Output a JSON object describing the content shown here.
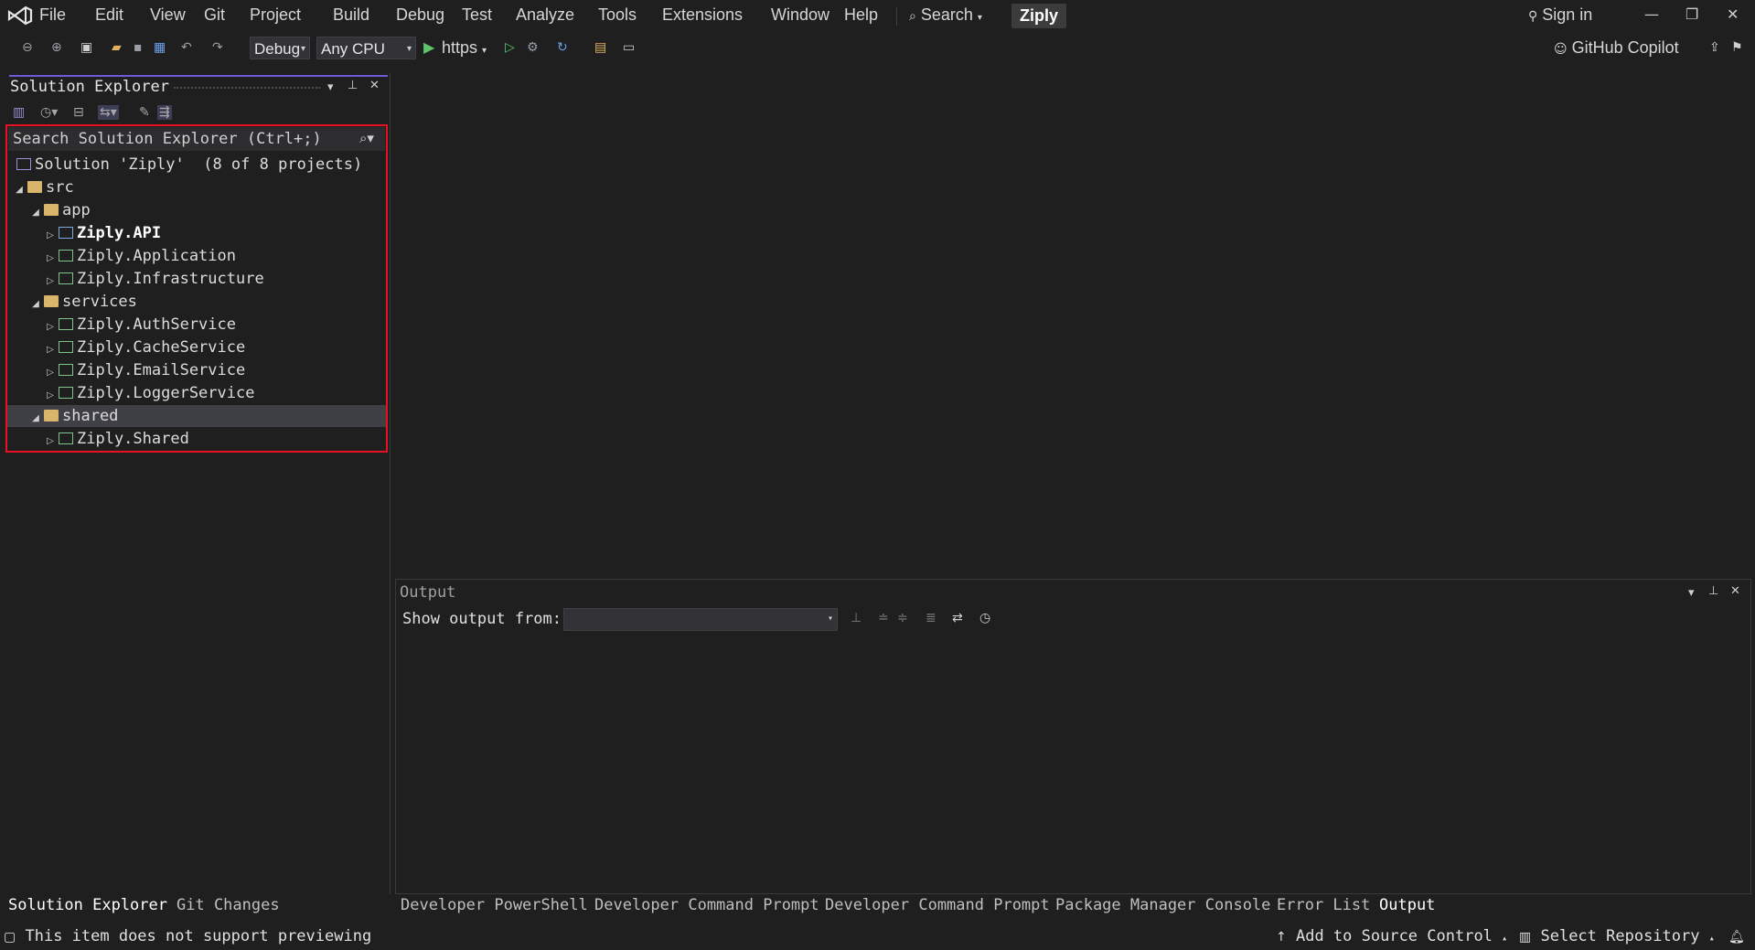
{
  "menubar": {
    "items": [
      "File",
      "Edit",
      "View",
      "Git",
      "Project",
      "Build",
      "Debug",
      "Test",
      "Analyze",
      "Tools",
      "Extensions",
      "Window",
      "Help"
    ],
    "search_label": "Search",
    "solution_name": "Ziply",
    "sign_in": "Sign in"
  },
  "toolbar": {
    "configuration": "Debug",
    "platform": "Any CPU",
    "run_profile": "https",
    "copilot_label": "GitHub Copilot"
  },
  "solution_explorer": {
    "title": "Solution Explorer",
    "search_placeholder": "Search Solution Explorer (Ctrl+;)",
    "tree": [
      {
        "label": "Solution 'Ziply'  (8 of 8 projects)",
        "depth": 0,
        "kind": "solution"
      },
      {
        "label": "src",
        "depth": 0,
        "kind": "folder",
        "expanded": true
      },
      {
        "label": "app",
        "depth": 1,
        "kind": "folder",
        "expanded": true
      },
      {
        "label": "Ziply.API",
        "depth": 2,
        "kind": "web-project",
        "startup": true
      },
      {
        "label": "Ziply.Application",
        "depth": 2,
        "kind": "project"
      },
      {
        "label": "Ziply.Infrastructure",
        "depth": 2,
        "kind": "project"
      },
      {
        "label": "services",
        "depth": 1,
        "kind": "folder",
        "expanded": true
      },
      {
        "label": "Ziply.AuthService",
        "depth": 2,
        "kind": "project"
      },
      {
        "label": "Ziply.CacheService",
        "depth": 2,
        "kind": "project"
      },
      {
        "label": "Ziply.EmailService",
        "depth": 2,
        "kind": "project"
      },
      {
        "label": "Ziply.LoggerService",
        "depth": 2,
        "kind": "project"
      },
      {
        "label": "shared",
        "depth": 1,
        "kind": "folder",
        "expanded": true,
        "selected": true
      },
      {
        "label": "Ziply.Shared",
        "depth": 2,
        "kind": "project"
      }
    ],
    "bottom_tabs": [
      "Solution Explorer",
      "Git Changes"
    ]
  },
  "output": {
    "title": "Output",
    "show_output_from": "Show output from:",
    "selected_source": ""
  },
  "bottom_tool_tabs": [
    "Developer PowerShell",
    "Developer Command Prompt",
    "Developer Command Prompt",
    "Package Manager Console",
    "Error List",
    "Output"
  ],
  "statusbar": {
    "message": "This item does not support previewing",
    "add_source_control": "Add to Source Control",
    "select_repository": "Select Repository"
  }
}
